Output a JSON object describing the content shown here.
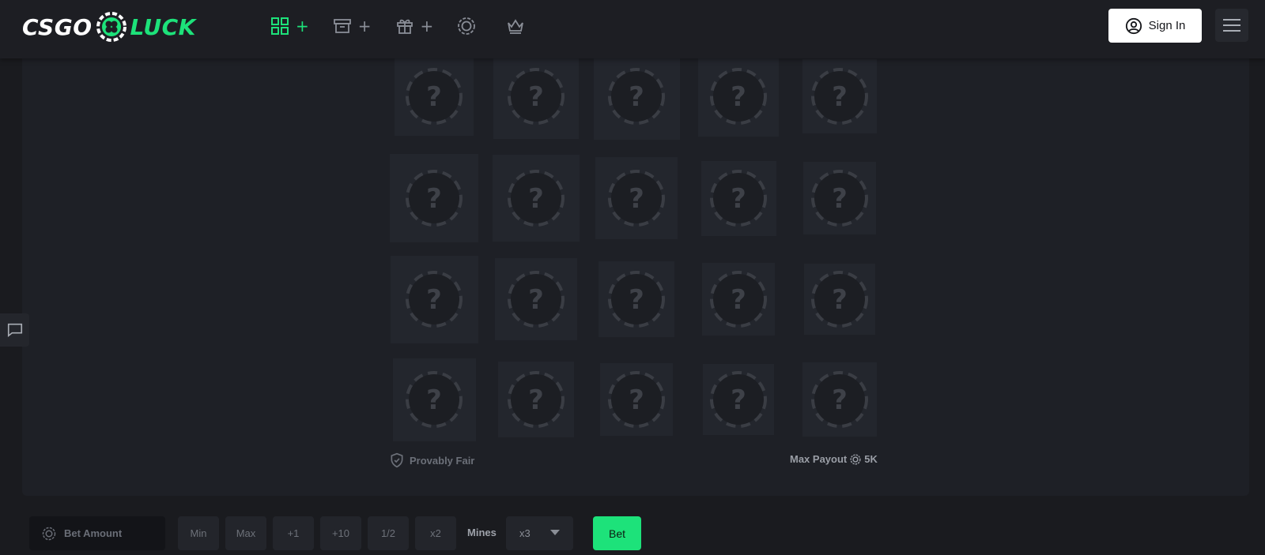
{
  "brand": {
    "left": "CSGO",
    "right": "LUCK"
  },
  "colors": {
    "accent": "#1de27a",
    "background": "#1a1b1f",
    "panel": "#1e2026",
    "tile": "#23262d"
  },
  "nav": [
    {
      "icon": "grid-icon",
      "plus": "+",
      "active": true
    },
    {
      "icon": "archive-box-icon",
      "plus": "+",
      "active": false
    },
    {
      "icon": "gift-icon",
      "plus": "+",
      "active": false
    },
    {
      "icon": "coin-icon",
      "active": false
    },
    {
      "icon": "crown-icon",
      "active": false
    }
  ],
  "header": {
    "signin_label": "Sign In",
    "menu_icon": "hamburger-icon"
  },
  "grid": {
    "rows": 4,
    "cols": 5,
    "tile_symbol": "?"
  },
  "footer_info": {
    "provably_fair": "Provably Fair",
    "max_payout_label": "Max Payout",
    "max_payout_value": "5K"
  },
  "controls": {
    "bet_placeholder": "Bet Amount",
    "quick": [
      "Min",
      "Max",
      "+1",
      "+10",
      "1/2",
      "x2"
    ],
    "mines_label": "Mines",
    "mines_value": "x3",
    "bet_label": "Bet"
  }
}
